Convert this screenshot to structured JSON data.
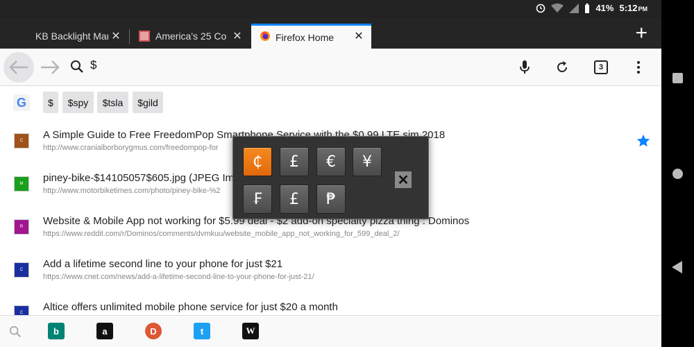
{
  "status": {
    "battery": "41%",
    "time": "5:12",
    "ampm": "PM"
  },
  "tabs": [
    {
      "title": "KB Backlight Mar"
    },
    {
      "title": "America's 25 Colc"
    },
    {
      "title": "Firefox Home"
    }
  ],
  "toolbar": {
    "url_text": "$",
    "tab_count": "3"
  },
  "suggestions": [
    "$",
    "$spy",
    "$tsla",
    "$gild"
  ],
  "history": [
    {
      "title": "A Simple Guide to Free FreedomPop Smartphone Service with the $0.99 LTE sim 2018",
      "url": "http://www.cranialborborygmus.com/freedompop-for",
      "favicon_letter": "C",
      "favicon_color": "#a0521a"
    },
    {
      "title": "piney-bike-$14105057$605.jpg (JPEG Ima",
      "url": "http://www.motorbiketimes.com/photo/piney-bike-%2",
      "favicon_letter": "M",
      "favicon_color": "#1aa01a"
    },
    {
      "title": "Website & Mobile App not working for $5.99 deal - $2 add-on specialty pizza thing : Dominos",
      "url": "https://www.reddit.com/r/Dominos/comments/dvmkuu/website_mobile_app_not_working_for_599_deal_2/",
      "favicon_letter": "R",
      "favicon_color": "#a0178f"
    },
    {
      "title": "Add a lifetime second line to your phone for just $21",
      "url": "https://www.cnet.com/news/add-a-lifetime-second-line-to-your-phone-for-just-21/",
      "favicon_letter": "C",
      "favicon_color": "#1a2f9f"
    },
    {
      "title": "Altice offers unlimited mobile phone service for just $20 a month",
      "url": "",
      "favicon_letter": "C",
      "favicon_color": "#1a2f9f"
    }
  ],
  "currency_keys": [
    "₵",
    "£",
    "€",
    "¥",
    "₣",
    "£",
    "₱"
  ],
  "engines": [
    {
      "name": "bing-icon",
      "glyph": "b",
      "color": "#008373"
    },
    {
      "name": "amazon-icon",
      "glyph": "a",
      "color": "#111111"
    },
    {
      "name": "duckduckgo-icon",
      "glyph": "D",
      "color": "#de5833"
    },
    {
      "name": "twitter-icon",
      "glyph": "t",
      "color": "#1da1f2"
    },
    {
      "name": "wikipedia-icon",
      "glyph": "W",
      "color": "#111111"
    }
  ],
  "colors": {
    "accent": "#0a84ff",
    "selected_key": "#f07c14",
    "star": "#0a84ff"
  }
}
